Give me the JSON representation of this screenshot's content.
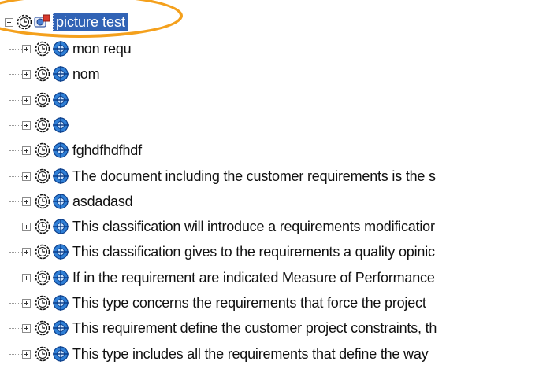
{
  "tree": {
    "root": {
      "label": "picture test",
      "expanded": true,
      "selected": true
    },
    "children": [
      {
        "label": "mon requ"
      },
      {
        "label": "nom"
      },
      {
        "label": ""
      },
      {
        "label": ""
      },
      {
        "label": "fghdfhdfhdf"
      },
      {
        "label": "The document including the customer requirements is the s"
      },
      {
        "label": "asdadasd"
      },
      {
        "label": "This classification will introduce a requirements modificatior"
      },
      {
        "label": "This classification gives to the requirements a quality opinic"
      },
      {
        "label": "If in the requirement are indicated Measure of Performance"
      },
      {
        "label": "This type concerns the requirements that force the project"
      },
      {
        "label": "This requirement define the customer project constraints, th"
      },
      {
        "label": "This type includes all the requirements that define the way"
      }
    ]
  },
  "colors": {
    "selection": "#3163b5",
    "highlight_oval": "#f4a01c",
    "tree_lines": "#9a9a9a"
  },
  "icons": {
    "gear": "gear-clock-icon",
    "target": "crosshair-globe-icon",
    "root": "picture-folder-icon"
  }
}
